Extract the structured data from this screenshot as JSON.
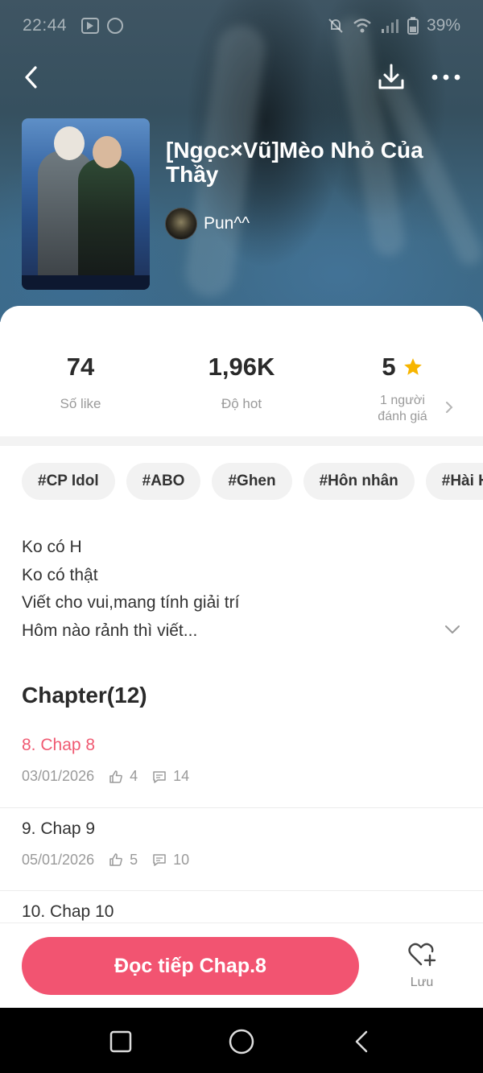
{
  "status_bar": {
    "time": "22:44",
    "battery": "39%"
  },
  "book": {
    "title": "[Ngọc×Vũ]Mèo Nhỏ Của Thầy",
    "author": "Pun^^"
  },
  "stats": {
    "likes_value": "74",
    "likes_label": "Số like",
    "hot_value": "1,96K",
    "hot_label": "Độ hot",
    "rating_value": "5",
    "rating_label_line1": "1 người",
    "rating_label_line2": "đánh giá"
  },
  "tags": [
    "#CP Idol",
    "#ABO",
    "#Ghen",
    "#Hôn nhân",
    "#Hài H"
  ],
  "description": [
    "Ko có H",
    "Ko có thật",
    "Viết cho vui,mang tính giải trí",
    "Hôm nào rảnh thì viết..."
  ],
  "chapter_section": {
    "heading": "Chapter(12)"
  },
  "chapters": [
    {
      "title": "8. Chap 8",
      "date": "03/01/2026",
      "likes": "4",
      "comments": "14",
      "current": true
    },
    {
      "title": "9. Chap 9",
      "date": "05/01/2026",
      "likes": "5",
      "comments": "10",
      "current": false
    },
    {
      "title": "10. Chap 10",
      "date": "",
      "likes": "",
      "comments": "",
      "current": false
    }
  ],
  "bottom_bar": {
    "read_button": "Đọc tiếp Chap.8",
    "save_label": "Lưu"
  },
  "colors": {
    "accent": "#f25471",
    "current_chapter": "#f05a72",
    "star": "#f7b500"
  },
  "icons": {
    "back": "chevron-left-icon",
    "download": "download-icon",
    "more": "more-dots-icon",
    "star": "star-icon",
    "like": "thumbs-up-icon",
    "comment": "comment-icon",
    "save": "heart-plus-icon",
    "expand": "chevron-down-icon"
  }
}
